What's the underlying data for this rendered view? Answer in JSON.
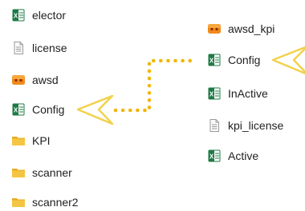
{
  "left_column": [
    {
      "label": "elector",
      "icon": "excel-file-icon"
    },
    {
      "label": "license",
      "icon": "text-file-icon"
    },
    {
      "label": "awsd",
      "icon": "app-exe-icon"
    },
    {
      "label": "Config",
      "icon": "excel-file-icon"
    },
    {
      "label": "KPI",
      "icon": "folder-icon"
    },
    {
      "label": "scanner",
      "icon": "folder-icon"
    },
    {
      "label": "scanner2",
      "icon": "folder-icon"
    }
  ],
  "right_column": [
    {
      "label": "awsd_kpi",
      "icon": "app-exe-icon"
    },
    {
      "label": "Config",
      "icon": "excel-file-icon"
    },
    {
      "label": "InActive",
      "icon": "excel-file-icon"
    },
    {
      "label": "kpi_license",
      "icon": "text-file-icon"
    },
    {
      "label": "Active",
      "icon": "excel-file-icon"
    }
  ],
  "annotation": {
    "arrow_color": "#f2d24c",
    "connector_color": "#f2b600"
  },
  "colors": {
    "excel_green": "#1e7a45",
    "folder_yellow": "#f4c542",
    "app_orange": "#f08a1a"
  }
}
